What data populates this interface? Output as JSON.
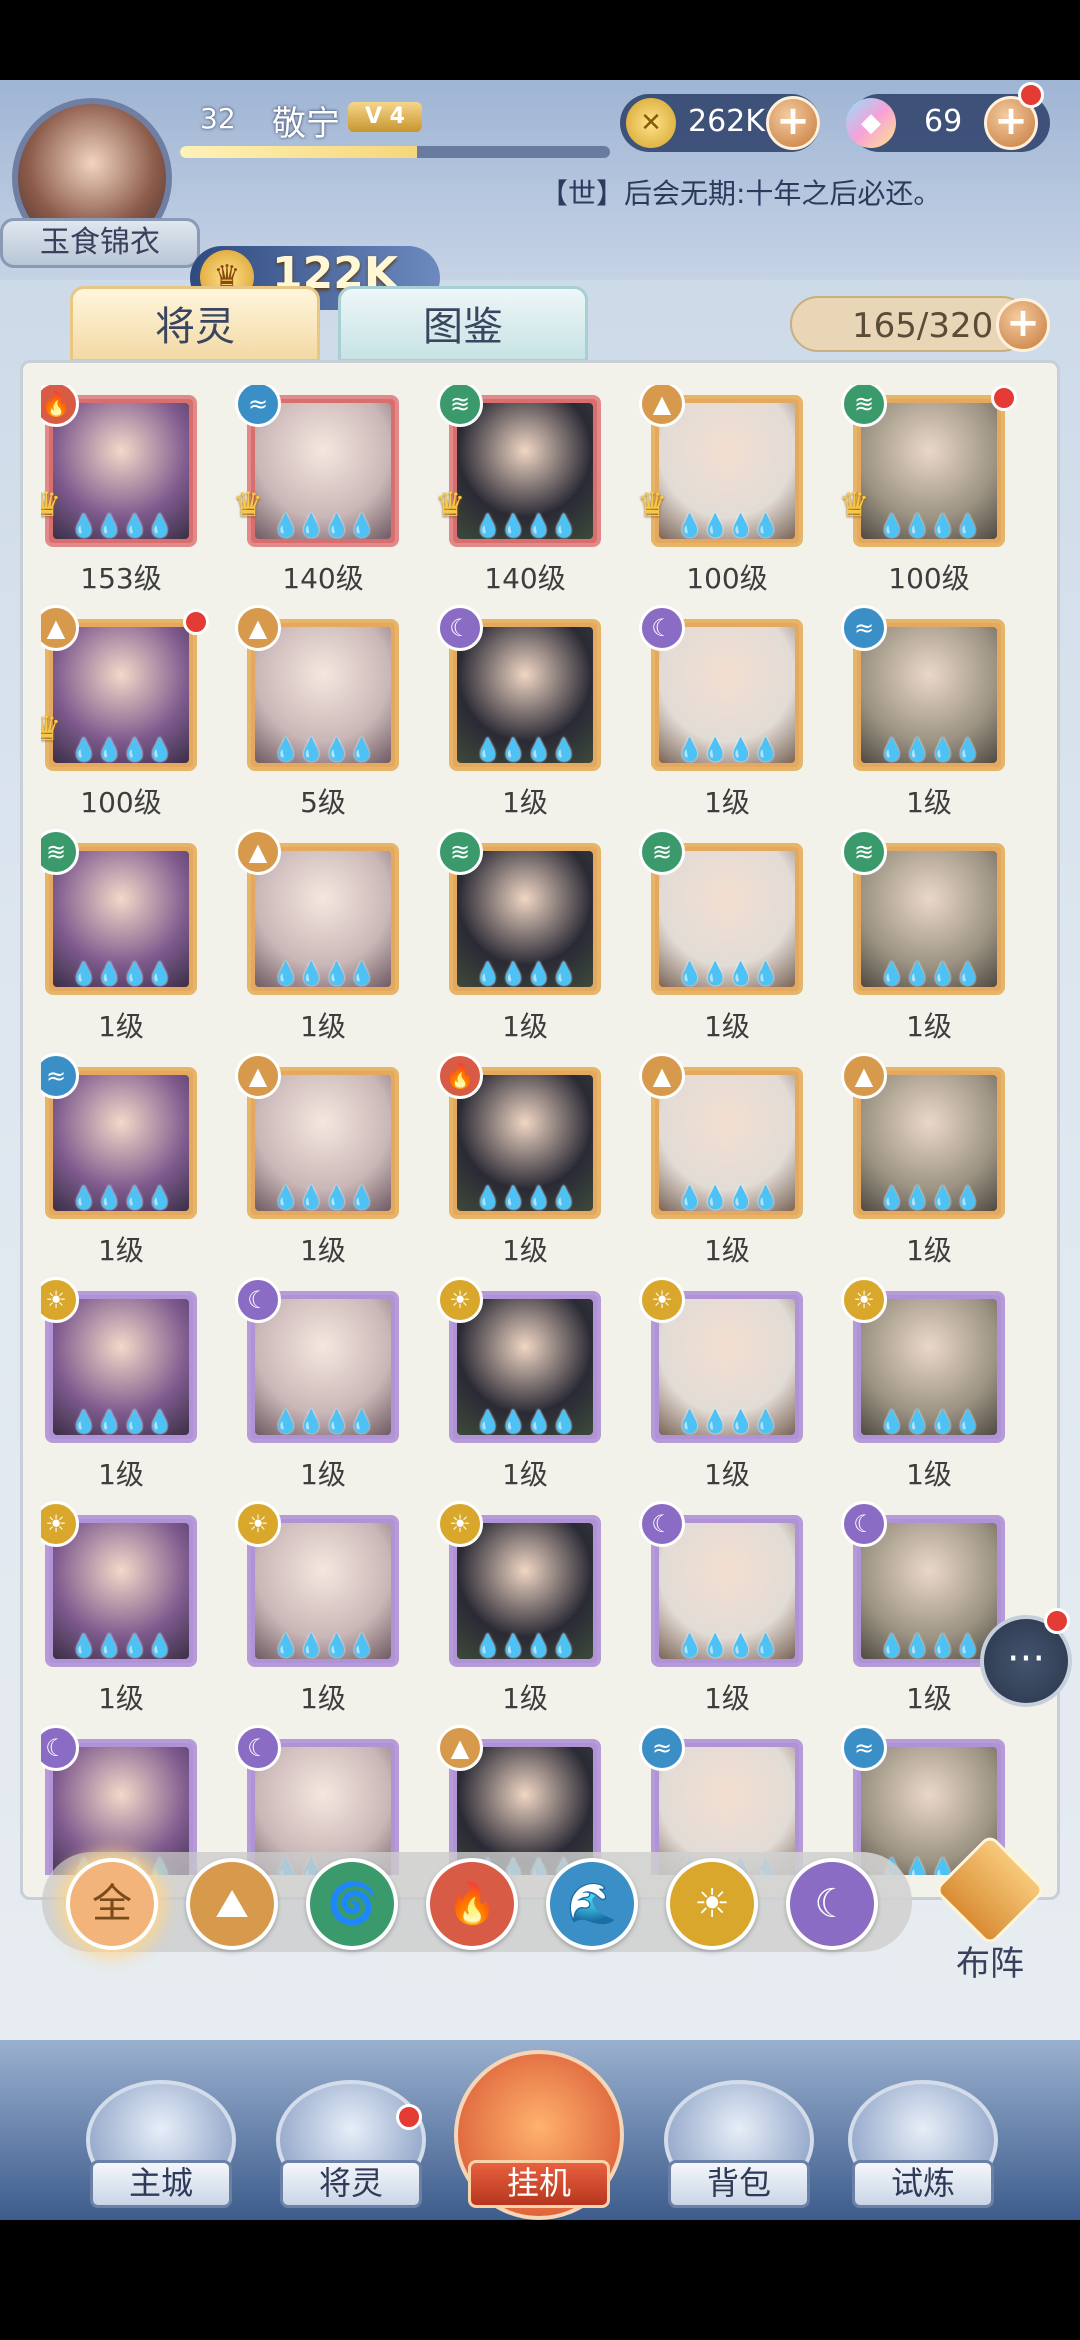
{
  "player": {
    "avatar_frame_title": "玉食锦衣",
    "level": "32",
    "name": "敬宁",
    "vip": "V 4",
    "exp_progress": 0.55,
    "power": "122K"
  },
  "resources": {
    "gold": "262K",
    "gems": "69"
  },
  "notice": "【世】后会无期:十年之后必还。",
  "tabs": {
    "heroes": "将灵",
    "codex": "图鉴"
  },
  "hero_count": "165/320",
  "heroes": [
    {
      "level": "153级",
      "element": "fire",
      "frame": "red",
      "crown": true
    },
    {
      "level": "140级",
      "element": "water",
      "frame": "red",
      "crown": true
    },
    {
      "level": "140级",
      "element": "wind",
      "frame": "red",
      "crown": true
    },
    {
      "level": "100级",
      "element": "mountain",
      "frame": "orange",
      "crown": true
    },
    {
      "level": "100级",
      "element": "wind",
      "frame": "orange",
      "crown": true,
      "badge": true
    },
    {
      "level": "100级",
      "element": "mountain",
      "frame": "orange",
      "crown": true,
      "badge": true
    },
    {
      "level": "5级",
      "element": "mountain",
      "frame": "orange"
    },
    {
      "level": "1级",
      "element": "moon",
      "frame": "orange"
    },
    {
      "level": "1级",
      "element": "moon",
      "frame": "orange"
    },
    {
      "level": "1级",
      "element": "water",
      "frame": "orange"
    },
    {
      "level": "1级",
      "element": "wind",
      "frame": "orange"
    },
    {
      "level": "1级",
      "element": "mountain",
      "frame": "orange"
    },
    {
      "level": "1级",
      "element": "wind",
      "frame": "orange"
    },
    {
      "level": "1级",
      "element": "wind",
      "frame": "orange"
    },
    {
      "level": "1级",
      "element": "wind",
      "frame": "orange"
    },
    {
      "level": "1级",
      "element": "water",
      "frame": "orange"
    },
    {
      "level": "1级",
      "element": "mountain",
      "frame": "orange"
    },
    {
      "level": "1级",
      "element": "fire",
      "frame": "orange"
    },
    {
      "level": "1级",
      "element": "mountain",
      "frame": "orange"
    },
    {
      "level": "1级",
      "element": "mountain",
      "frame": "orange"
    },
    {
      "level": "1级",
      "element": "sun",
      "frame": "purple"
    },
    {
      "level": "1级",
      "element": "moon",
      "frame": "purple"
    },
    {
      "level": "1级",
      "element": "sun",
      "frame": "purple"
    },
    {
      "level": "1级",
      "element": "sun",
      "frame": "purple"
    },
    {
      "level": "1级",
      "element": "sun",
      "frame": "purple"
    },
    {
      "level": "1级",
      "element": "sun",
      "frame": "purple"
    },
    {
      "level": "1级",
      "element": "sun",
      "frame": "purple"
    },
    {
      "level": "1级",
      "element": "sun",
      "frame": "purple"
    },
    {
      "level": "1级",
      "element": "moon",
      "frame": "purple"
    },
    {
      "level": "1级",
      "element": "moon",
      "frame": "purple"
    },
    {
      "level": "",
      "element": "moon",
      "frame": "purple"
    },
    {
      "level": "",
      "element": "moon",
      "frame": "purple"
    },
    {
      "level": "",
      "element": "mountain",
      "frame": "purple"
    },
    {
      "level": "",
      "element": "water",
      "frame": "purple"
    },
    {
      "level": "",
      "element": "water",
      "frame": "purple"
    }
  ],
  "filters": [
    {
      "name": "all",
      "label": "全",
      "color": "#f2b47a"
    },
    {
      "name": "mountain",
      "label": "⛰",
      "color": "#d79a4c"
    },
    {
      "name": "wind",
      "label": "🌀",
      "color": "#3b9a6b"
    },
    {
      "name": "fire",
      "label": "🔥",
      "color": "#d85c45"
    },
    {
      "name": "water",
      "label": "🌊",
      "color": "#3a8fc6"
    },
    {
      "name": "sun",
      "label": "☀",
      "color": "#d8a72c"
    },
    {
      "name": "moon",
      "label": "☾",
      "color": "#8a6cc4"
    }
  ],
  "formation_label": "布阵",
  "nav": {
    "main_city": "主城",
    "heroes": "将灵",
    "idle": "挂机",
    "bag": "背包",
    "trial": "试炼"
  },
  "element_colors": {
    "fire": "#d85c45",
    "water": "#3a8fc6",
    "wind": "#3b9a6b",
    "mountain": "#d79a4c",
    "moon": "#8a6cc4",
    "sun": "#d8a72c"
  },
  "element_glyphs": {
    "fire": "🔥",
    "water": "≈",
    "wind": "≋",
    "mountain": "▲",
    "moon": "☾",
    "sun": "☀"
  }
}
